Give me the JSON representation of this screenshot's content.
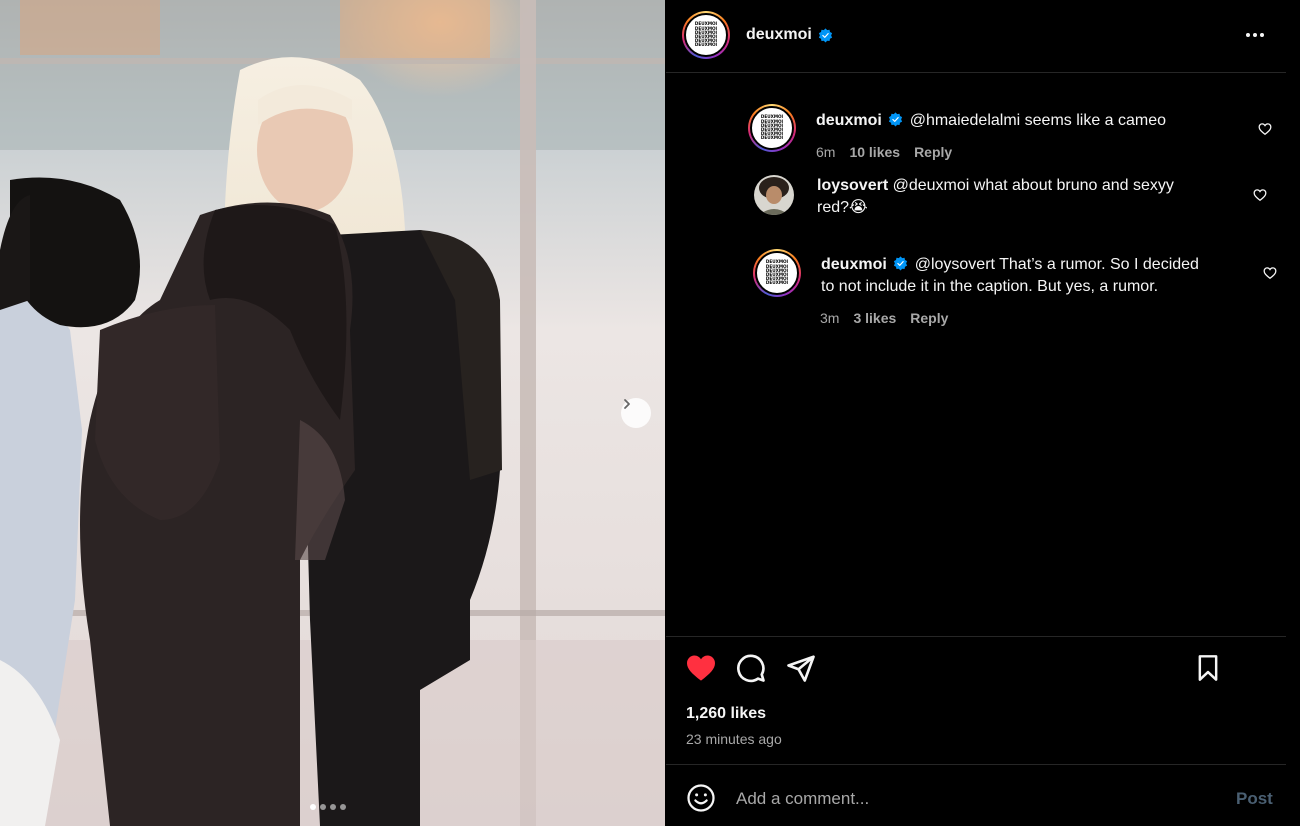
{
  "post": {
    "author": "deuxmoi",
    "avatar_text": [
      "DEUXMOI",
      "DEUXMOI",
      "DEUXMOI",
      "DEUXMOI",
      "DEUXMOI",
      "DEUXMOI"
    ],
    "carousel_dots": 4,
    "carousel_active": 0
  },
  "comments": [
    {
      "user": "deuxmoi",
      "verified": true,
      "text": "@hmaiedelalmi seems like a cameo",
      "time": "6m",
      "likes": "10 likes",
      "reply": "Reply"
    },
    {
      "user": "loysovert",
      "verified": false,
      "text_line1": "@deuxmoi what about bruno and sexyy",
      "text_line2": "red?",
      "emoji": "😭"
    },
    {
      "user": "deuxmoi",
      "verified": true,
      "text_line1": "@loysovert That’s a rumor. So I decided",
      "text_line2": "to not include it in the caption. But yes, a rumor.",
      "time": "3m",
      "likes": "3 likes",
      "reply": "Reply"
    }
  ],
  "engagement": {
    "likes": "1,260 likes",
    "time_ago": "23 minutes ago",
    "liked": true
  },
  "composer": {
    "placeholder": "Add a comment...",
    "post_label": "Post"
  },
  "colors": {
    "background": "#000000",
    "text": "#f5f5f5",
    "muted": "#a8a8a8",
    "verified": "#0095f6",
    "like_red": "#ff3040",
    "post_disabled": "#4a5f72"
  }
}
